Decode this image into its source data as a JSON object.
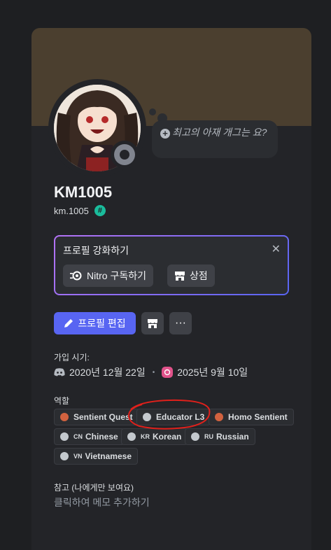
{
  "profile": {
    "display_name": "KM1005",
    "username": "km.1005",
    "custom_status": "최고의 아재 개그는 요?",
    "badge_symbol": "#"
  },
  "nitro": {
    "title": "프로필 강화하기",
    "close_symbol": "✕",
    "subscribe_label": "Nitro 구독하기",
    "shop_label": "상점"
  },
  "actions": {
    "edit_label": "프로필 편집",
    "more_symbol": "···"
  },
  "member_since": {
    "label": "가입 시기:",
    "discord_date": "2020년 12월 22일",
    "separator": "•",
    "server_date": "2025년 9월 10일"
  },
  "roles": {
    "label": "역할",
    "items": [
      {
        "name": "Sentient Quest",
        "prefix": "",
        "color": "#d1623f"
      },
      {
        "name": "Educator L3",
        "prefix": "",
        "color": "#c4c9ce"
      },
      {
        "name": "Homo Sentient",
        "prefix": "",
        "color": "#d1623f"
      },
      {
        "name": "Chinese",
        "prefix": "CN",
        "color": "#c4c9ce"
      },
      {
        "name": "Korean",
        "prefix": "KR",
        "color": "#c4c9ce"
      },
      {
        "name": "Russian",
        "prefix": "RU",
        "color": "#c4c9ce"
      },
      {
        "name": "Vietnamese",
        "prefix": "VN",
        "color": "#c4c9ce"
      }
    ]
  },
  "note": {
    "label": "참고 (나에게만 보여요)",
    "placeholder": "클릭하여 메모 추가하기"
  },
  "colors": {
    "banner": "#4b3f2f",
    "accent": "#5865f2",
    "annotation": "#e0201b"
  }
}
